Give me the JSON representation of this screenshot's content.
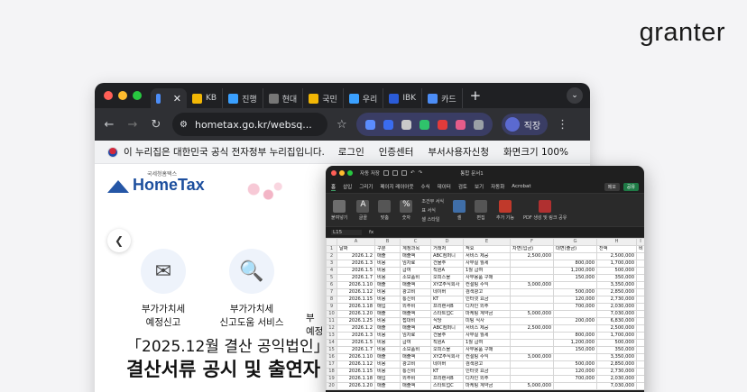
{
  "brand": {
    "logo": "granter"
  },
  "browser": {
    "tabs": [
      {
        "label": "",
        "color": "#4c8df6",
        "active": true
      },
      {
        "label": "KB",
        "color": "#f2b705"
      },
      {
        "label": "진행",
        "color": "#3aa0ff"
      },
      {
        "label": "현대",
        "color": "#777777"
      },
      {
        "label": "국민",
        "color": "#f2b705"
      },
      {
        "label": "우리",
        "color": "#3aa0ff"
      },
      {
        "label": "IBK",
        "color": "#2a5bd7"
      },
      {
        "label": "카드",
        "color": "#4c8df6"
      }
    ],
    "url": "hometax.go.kr/websq...",
    "profile_label": "직장",
    "gov_banner": "이 누리집은 대한민국 공식 전자정부 누리집입니다.",
    "gov_links": [
      "로그인",
      "인증센터",
      "부서사용자신청",
      "화면크기 100%"
    ]
  },
  "hometax": {
    "logo_text": "HomeTax",
    "logo_sub": "국세청홈택스",
    "services": [
      {
        "icon": "tax-envelope-icon",
        "label_line1": "부가가치세",
        "label_line2": "예정신고"
      },
      {
        "icon": "tax-search-icon",
        "label_line1": "부가가치세",
        "label_line2": "신고도움 서비스"
      },
      {
        "icon": "tax-doc-icon",
        "label_line1": "부",
        "label_line2": "예정"
      }
    ],
    "headline_line1": "「2025.12월 결산 공익법인」",
    "headline_line2": "결산서류 공시 및 출연자"
  },
  "excel": {
    "filename": "통합 문서1",
    "autosave": "자동 저장",
    "ribbon_tabs": [
      "홈",
      "삽입",
      "그리기",
      "페이지 레이아웃",
      "수식",
      "데이터",
      "검토",
      "보기",
      "자동화",
      "Acrobat"
    ],
    "btn_memo": "메모",
    "btn_share": "공유",
    "ribbon_groups": [
      "붙여넣기",
      "글꼴",
      "맞춤",
      "숫자",
      "조건부 서식",
      "표 서식",
      "셀 스타일",
      "셀",
      "편집",
      "추가 기능",
      "PDF 생성 및 링크 공유"
    ],
    "name_box": "L15",
    "fx": "fx",
    "col_letters": [
      "",
      "A",
      "B",
      "C",
      "D",
      "E",
      "F",
      "G",
      "H",
      "I"
    ],
    "headers": [
      "날짜",
      "구분",
      "계정과목",
      "거래처",
      "적요",
      "차변(입금)",
      "대변(출금)",
      "잔액",
      "비"
    ],
    "rows": [
      [
        "2026.1.2",
        "매출",
        "매출액",
        "ABC컴퍼니",
        "서비스 제공",
        "2,500,000",
        "",
        "2,500,000"
      ],
      [
        "2026.1.3",
        "비용",
        "임차료",
        "건물주",
        "사무실 월세",
        "",
        "800,000",
        "1,700,000"
      ],
      [
        "2026.1.5",
        "비용",
        "급여",
        "직원A",
        "1월 급여",
        "",
        "1,200,000",
        "500,000"
      ],
      [
        "2026.1.7",
        "비용",
        "소모품비",
        "오피스몰",
        "사무용품 구매",
        "",
        "150,000",
        "350,000"
      ],
      [
        "2026.1.10",
        "매출",
        "매출액",
        "XYZ주식회사",
        "컨설팅 수익",
        "3,000,000",
        "",
        "3,350,000"
      ],
      [
        "2026.1.12",
        "비용",
        "광고비",
        "네이버",
        "검색광고",
        "",
        "500,000",
        "2,850,000"
      ],
      [
        "2026.1.15",
        "비용",
        "통신비",
        "KT",
        "인터넷 요금",
        "",
        "120,000",
        "2,730,000"
      ],
      [
        "2026.1.18",
        "매입",
        "외주비",
        "프리랜서B",
        "디자인 외주",
        "",
        "700,000",
        "2,030,000"
      ],
      [
        "2026.1.20",
        "매출",
        "매출액",
        "스타트업C",
        "마케팅 계약금",
        "5,000,000",
        "",
        "7,030,000"
      ],
      [
        "2026.1.25",
        "비용",
        "접대비",
        "식당",
        "미팅 식사",
        "",
        "200,000",
        "6,830,000"
      ],
      [
        "2026.1.2",
        "매출",
        "매출액",
        "ABC컴퍼니",
        "서비스 제공",
        "2,500,000",
        "",
        "2,500,000"
      ],
      [
        "2026.1.3",
        "비용",
        "임차료",
        "건물주",
        "사무실 월세",
        "",
        "800,000",
        "1,700,000"
      ],
      [
        "2026.1.5",
        "비용",
        "급여",
        "직원A",
        "1월 급여",
        "",
        "1,200,000",
        "500,000"
      ],
      [
        "2026.1.7",
        "비용",
        "소모품비",
        "오피스몰",
        "사무용품 구매",
        "",
        "150,000",
        "350,000"
      ],
      [
        "2026.1.10",
        "매출",
        "매출액",
        "XYZ주식회사",
        "컨설팅 수익",
        "3,000,000",
        "",
        "3,350,000"
      ],
      [
        "2026.1.12",
        "비용",
        "광고비",
        "네이버",
        "검색광고",
        "",
        "500,000",
        "2,850,000"
      ],
      [
        "2026.1.15",
        "비용",
        "통신비",
        "KT",
        "인터넷 요금",
        "",
        "120,000",
        "2,730,000"
      ],
      [
        "2026.1.18",
        "매입",
        "외주비",
        "프리랜서B",
        "디자인 외주",
        "",
        "700,000",
        "2,030,000"
      ],
      [
        "2026.1.20",
        "매출",
        "매출액",
        "스타트업C",
        "마케팅 계약금",
        "5,000,000",
        "",
        "7,030,000"
      ]
    ]
  }
}
